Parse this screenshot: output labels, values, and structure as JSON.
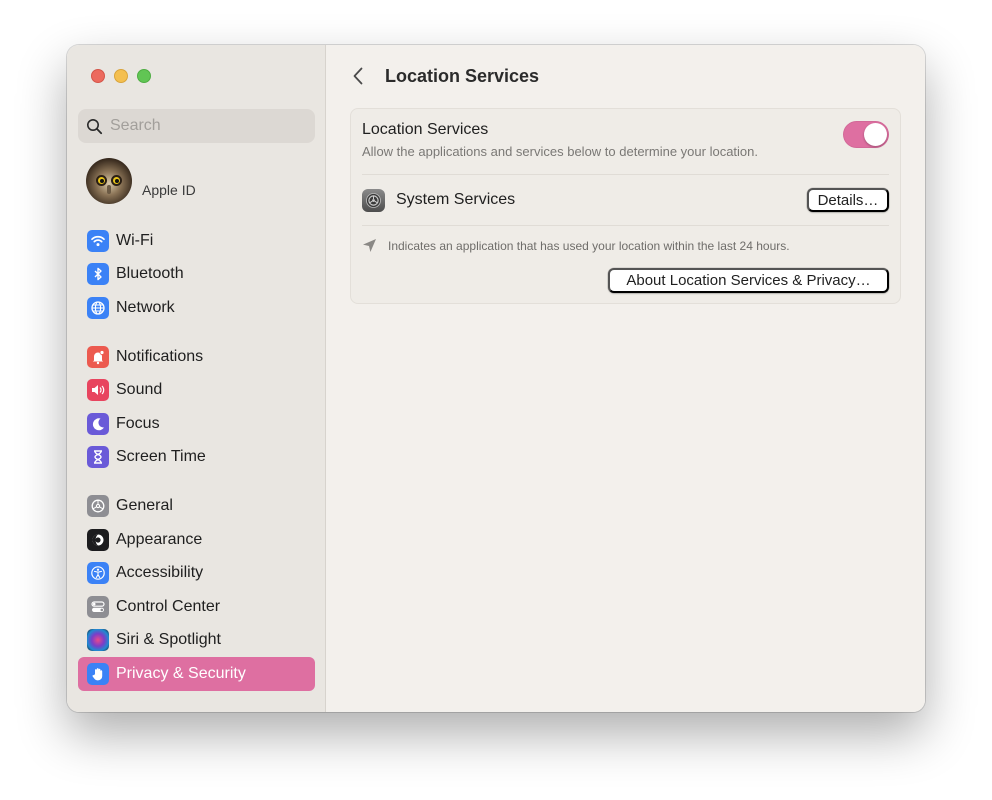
{
  "window": {
    "traffic_lights": [
      "close",
      "minimize",
      "zoom"
    ]
  },
  "sidebar": {
    "search": {
      "placeholder": "Search",
      "value": ""
    },
    "account": {
      "label": "Apple ID",
      "avatar": "owl-avatar"
    },
    "groups": [
      [
        {
          "label": "Wi-Fi",
          "icon": "wifi-icon",
          "color": "#3b82f6"
        },
        {
          "label": "Bluetooth",
          "icon": "bluetooth-icon",
          "color": "#3b82f6"
        },
        {
          "label": "Network",
          "icon": "globe-icon",
          "color": "#3b82f6"
        }
      ],
      [
        {
          "label": "Notifications",
          "icon": "bell-icon",
          "color": "#ec5a4f"
        },
        {
          "label": "Sound",
          "icon": "speaker-icon",
          "color": "#e8455f"
        },
        {
          "label": "Focus",
          "icon": "moon-icon",
          "color": "#6a5ad8"
        },
        {
          "label": "Screen Time",
          "icon": "hourglass-icon",
          "color": "#6a5ad8"
        }
      ],
      [
        {
          "label": "General",
          "icon": "gear-icon",
          "color": "#8e8e93"
        },
        {
          "label": "Appearance",
          "icon": "appearance-icon",
          "color": "#1c1c1e"
        },
        {
          "label": "Accessibility",
          "icon": "accessibility-icon",
          "color": "#3b82f6"
        },
        {
          "label": "Control Center",
          "icon": "switches-icon",
          "color": "#8e8e93"
        },
        {
          "label": "Siri & Spotlight",
          "icon": "siri-icon",
          "color": "#2b2b3a"
        },
        {
          "label": "Privacy & Security",
          "icon": "hand-icon",
          "color": "#3b82f6",
          "selected": true
        }
      ]
    ],
    "selected_color": "#de6fa1"
  },
  "main": {
    "title": "Location Services",
    "back_label": "Back",
    "card": {
      "location_services": {
        "title": "Location Services",
        "description": "Allow the applications and services below to determine your location.",
        "enabled": true,
        "toggle_color": "#de6fa1"
      },
      "system_services": {
        "label": "System Services",
        "details_button": "Details…"
      },
      "note": "Indicates an application that has used your location within the last 24 hours.",
      "about_button": "About Location Services & Privacy…"
    }
  }
}
